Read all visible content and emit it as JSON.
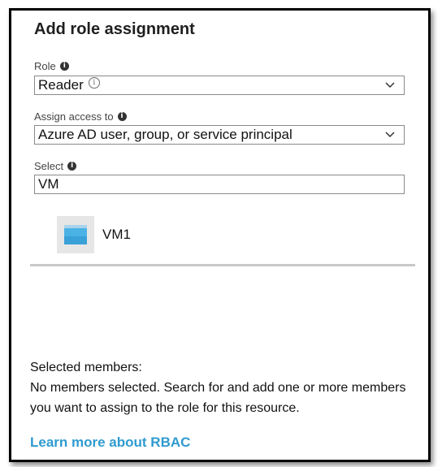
{
  "title": "Add role assignment",
  "role": {
    "label": "Role",
    "value": "Reader",
    "info_icon": "info-icon"
  },
  "assign_access": {
    "label": "Assign access to",
    "value": "Azure AD user, group, or service principal"
  },
  "select": {
    "label": "Select",
    "value": "VM"
  },
  "results": [
    {
      "name": "VM1",
      "icon": "virtual-machine-icon"
    }
  ],
  "selected_members": {
    "heading": "Selected members:",
    "message": "No members selected. Search for and add one or more members you want to assign to the role for this resource."
  },
  "learn_more_link": "Learn more about RBAC",
  "colors": {
    "link": "#2f9bd0",
    "vm_icon": "#3aa0d8",
    "divider": "#c8c8c8"
  }
}
